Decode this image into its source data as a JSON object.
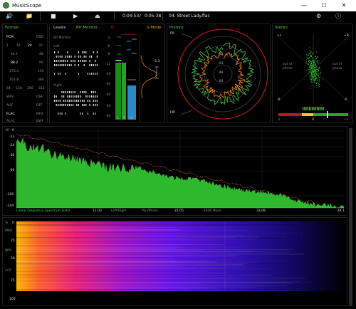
{
  "window": {
    "title": "MusicScope",
    "minimize": "—",
    "maximize": "☐",
    "close": "✕"
  },
  "toolbar": {
    "position": "0:04:53",
    "divider": "/",
    "duration": "0:05:38",
    "track": "04. Street Lady.flac"
  },
  "format": {
    "title": "Format",
    "rows": [
      [
        "PCM",
        "DSD"
      ],
      [
        "1",
        "16",
        "24",
        "32"
      ],
      [
        "44.1",
        "48"
      ],
      [
        "88.2",
        "96"
      ],
      [
        "176.4",
        "192"
      ],
      [
        "352.8",
        "384"
      ],
      [
        "64",
        "128",
        "256",
        "512"
      ],
      [
        "WAV",
        "DSF"
      ],
      [
        "AIFF",
        "DFF"
      ],
      [
        "FLAC",
        "MP3"
      ],
      [
        "ALAC",
        "BWF"
      ]
    ]
  },
  "levels": {
    "title": "Levels",
    "subtitle": "Bit Monitor",
    "bit_monitor_label": "Bit Monitor",
    "left_label": "Left",
    "right_label": "Right",
    "s_mode": "S-Mode",
    "scale_top": [
      "0",
      "-3",
      "-6",
      "-9"
    ],
    "scale_main": [
      "-12",
      "-20",
      "-30",
      "-40",
      "-50",
      "-60"
    ],
    "bar_labels": [
      "L",
      "R",
      "LU"
    ],
    "readout": "5.3"
  },
  "history": {
    "title": "History",
    "pl_label": "PlL",
    "plr_label": "PlR",
    "ring_labels": [
      "-12",
      "-24",
      "-48",
      "-60"
    ]
  },
  "stereo": {
    "title": "Stereo",
    "plus_l": "+L",
    "plus_r": "+R",
    "minus_l": "-R",
    "minus_r": "-R",
    "out_left": "out of phase",
    "out_right": "out of phase",
    "corr_labels": [
      "-1",
      "0",
      "+1"
    ]
  },
  "spectrum": {
    "db_label": "dB",
    "y_ticks": [
      "0",
      "-12",
      "-24",
      "-36",
      "-60",
      "-100",
      "-144"
    ],
    "x_ticks": [
      "11.03",
      "22.05",
      "33.08",
      "44.1"
    ],
    "mode_label": "Linear Frequency Spectrum (kHz)",
    "modes": [
      "Left/Right",
      "Pan/Phase",
      "-20dB Mode"
    ]
  },
  "spectrogram": {
    "pct_label": "%",
    "y_ticks": [
      "0",
      "25",
      "50",
      "75",
      "100"
    ],
    "side_labels": [
      "MAX",
      "BRY",
      "COF"
    ]
  },
  "colors": {
    "green": "#4bd24b",
    "orange": "#ff8c1a",
    "red": "#ff3030",
    "blue": "#2a89c7"
  }
}
